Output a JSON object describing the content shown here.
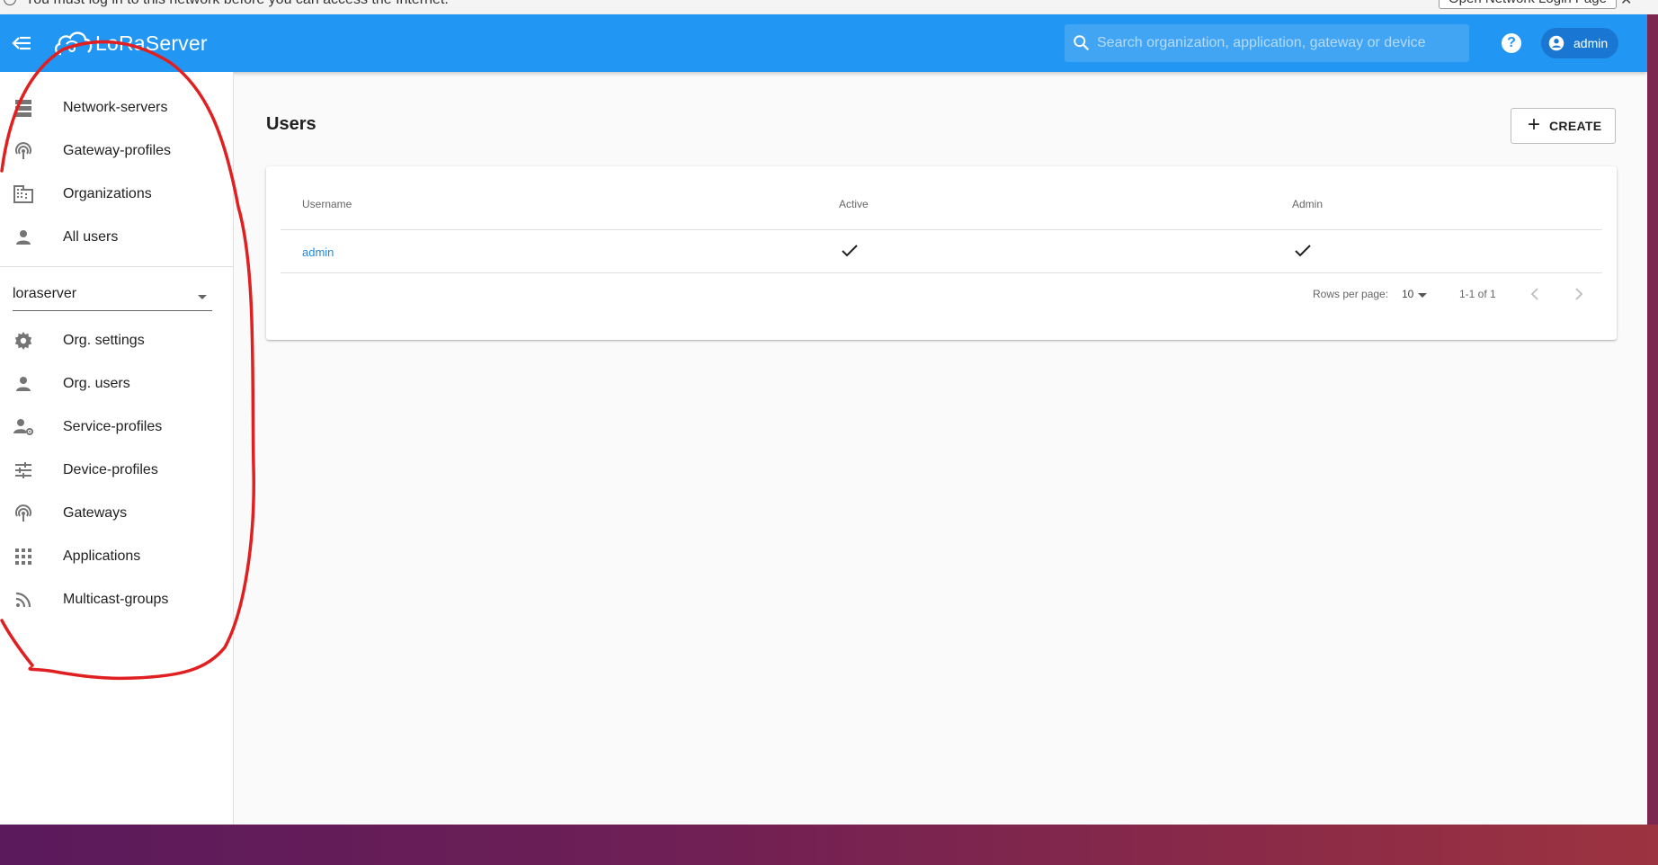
{
  "notice": {
    "text": "You must log in to this network before you can access the Internet.",
    "button_label": "Open Network Login Page",
    "close": "✕"
  },
  "appbar": {
    "logo_text": "LoRaServer",
    "search_placeholder": "Search organization, application, gateway or device",
    "help_label": "?",
    "user_label": "admin"
  },
  "sidebar": {
    "global_items": [
      {
        "label": "Network-servers",
        "icon": "dns-icon"
      },
      {
        "label": "Gateway-profiles",
        "icon": "radar-icon"
      },
      {
        "label": "Organizations",
        "icon": "domain-icon"
      },
      {
        "label": "All users",
        "icon": "person-icon"
      }
    ],
    "org_select_value": "loraserver",
    "org_items": [
      {
        "label": "Org. settings",
        "icon": "gear-icon"
      },
      {
        "label": "Org. users",
        "icon": "person-icon"
      },
      {
        "label": "Service-profiles",
        "icon": "account-settings-icon"
      },
      {
        "label": "Device-profiles",
        "icon": "tune-icon"
      },
      {
        "label": "Gateways",
        "icon": "radar-icon"
      },
      {
        "label": "Applications",
        "icon": "apps-grid-icon"
      },
      {
        "label": "Multicast-groups",
        "icon": "rss-icon"
      }
    ]
  },
  "main": {
    "title": "Users",
    "create_label": "CREATE",
    "table": {
      "columns": [
        "Username",
        "Active",
        "Admin"
      ],
      "rows": [
        {
          "username": "admin",
          "active": true,
          "admin": true
        }
      ]
    },
    "pagination": {
      "rows_per_page_label": "Rows per page:",
      "rows_per_page_value": "10",
      "range": "1-1 of 1"
    }
  },
  "colors": {
    "appbar": "#2196f3",
    "link": "#1e88e5",
    "annotation": "#e02020"
  }
}
